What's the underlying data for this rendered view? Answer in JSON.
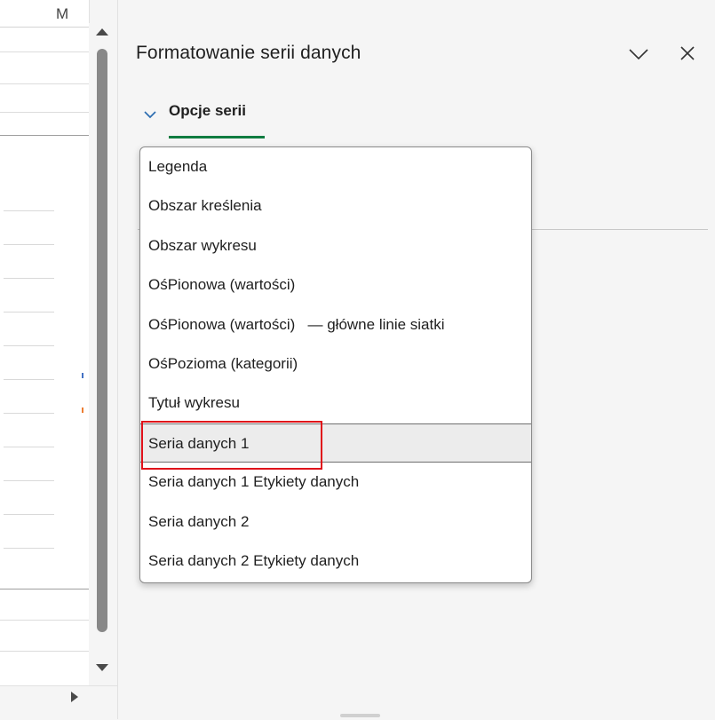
{
  "sheet": {
    "column_letter": "M"
  },
  "pane": {
    "title": "Formatowanie serii danych",
    "section_label": "Opcje serii",
    "chevron_icon": "chevron-down-icon",
    "close_icon": "close-icon"
  },
  "dropdown": {
    "items": [
      {
        "label": "Legenda"
      },
      {
        "label": "Obszar kreślenia"
      },
      {
        "label": "Obszar wykresu"
      },
      {
        "label": "OśPionowa (wartości)"
      },
      {
        "label": "OśPionowa (wartości)   — główne linie siatki"
      },
      {
        "label": "OśPozioma (kategorii)"
      },
      {
        "label": "Tytuł wykresu"
      },
      {
        "label": "Seria danych 1"
      },
      {
        "label": "Seria danych 1 Etykiety danych"
      },
      {
        "label": "Seria danych 2"
      },
      {
        "label": "Seria danych 2 Etykiety danych"
      }
    ],
    "selected_label": "Seria danych 1"
  },
  "colors": {
    "accent_underline": "#107c41",
    "highlight_box": "#e0111a"
  }
}
